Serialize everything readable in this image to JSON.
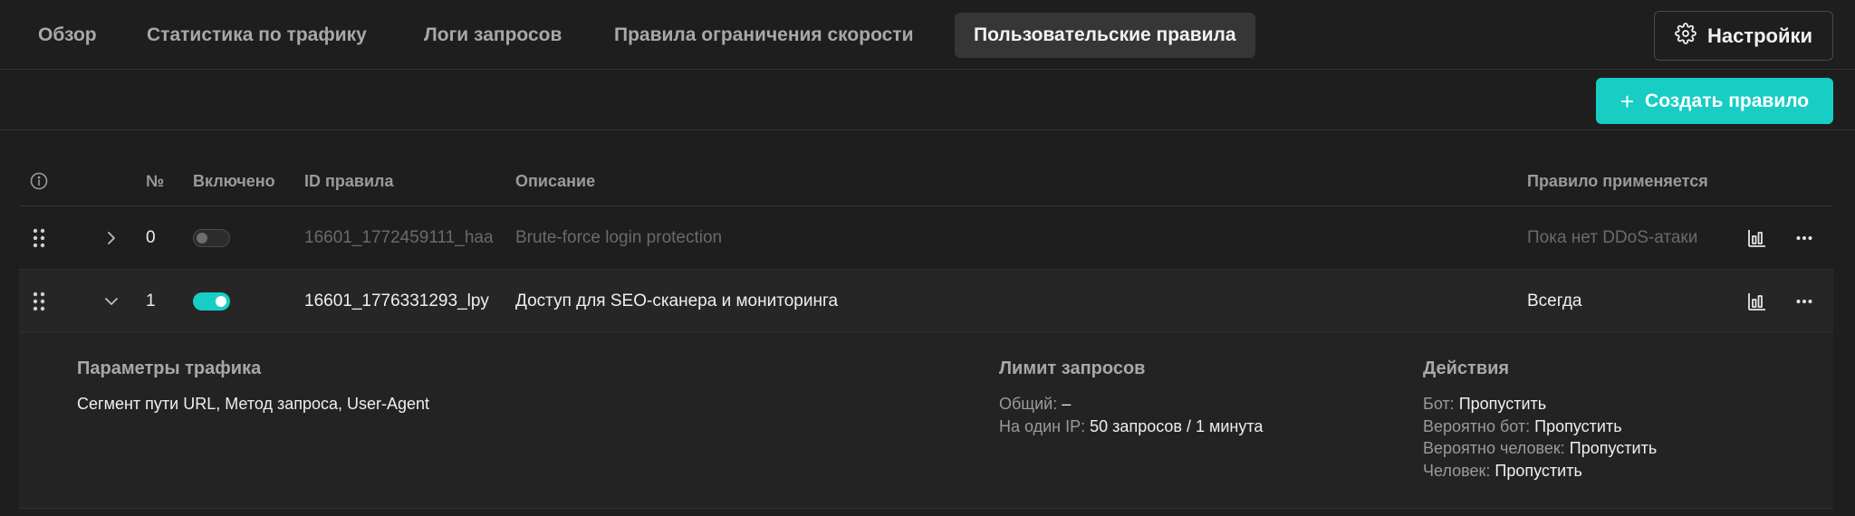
{
  "tabs": [
    {
      "label": "Обзор",
      "active": false
    },
    {
      "label": "Статистика по трафику",
      "active": false
    },
    {
      "label": "Логи запросов",
      "active": false
    },
    {
      "label": "Правила ограничения скорости",
      "active": false
    },
    {
      "label": "Пользовательские правила",
      "active": true
    }
  ],
  "settings_label": "Настройки",
  "create_rule_label": "Создать правило",
  "columns": {
    "number": "№",
    "enabled": "Включено",
    "rule_id": "ID правила",
    "description": "Описание",
    "applies": "Правило применяется"
  },
  "rows": [
    {
      "number": "0",
      "enabled": false,
      "rule_id": "16601_1772459111_haa",
      "description": "Brute-force login protection",
      "applies": "Пока нет DDoS-атаки",
      "expanded": false
    },
    {
      "number": "1",
      "enabled": true,
      "rule_id": "16601_1776331293_lpy",
      "description": "Доступ для SEO-сканера и мониторинга",
      "applies": "Всегда",
      "expanded": true
    }
  ],
  "details": {
    "traffic": {
      "title": "Параметры трафика",
      "value": "Сегмент пути URL, Метод запроса, User-Agent"
    },
    "limit": {
      "title": "Лимит запросов",
      "total_label": "Общий:",
      "total_value": "–",
      "per_ip_label": "На один IP:",
      "per_ip_value": "50 запросов / 1 минута"
    },
    "actions": {
      "title": "Действия",
      "items": [
        {
          "label": "Бот:",
          "value": "Пропустить"
        },
        {
          "label": "Вероятно бот:",
          "value": "Пропустить"
        },
        {
          "label": "Вероятно человек:",
          "value": "Пропустить"
        },
        {
          "label": "Человек:",
          "value": "Пропустить"
        }
      ]
    }
  },
  "colors": {
    "accent": "#17cdc4",
    "background": "#1e1e1e",
    "active_tab": "#363636"
  },
  "icons": {
    "settings": "gear-icon",
    "create": "plus-icon",
    "info": "info-icon",
    "drag": "drag-handle-icon",
    "expand": "chevron-right-icon",
    "collapse": "chevron-down-icon",
    "stats": "bar-chart-icon",
    "more": "more-icon"
  }
}
